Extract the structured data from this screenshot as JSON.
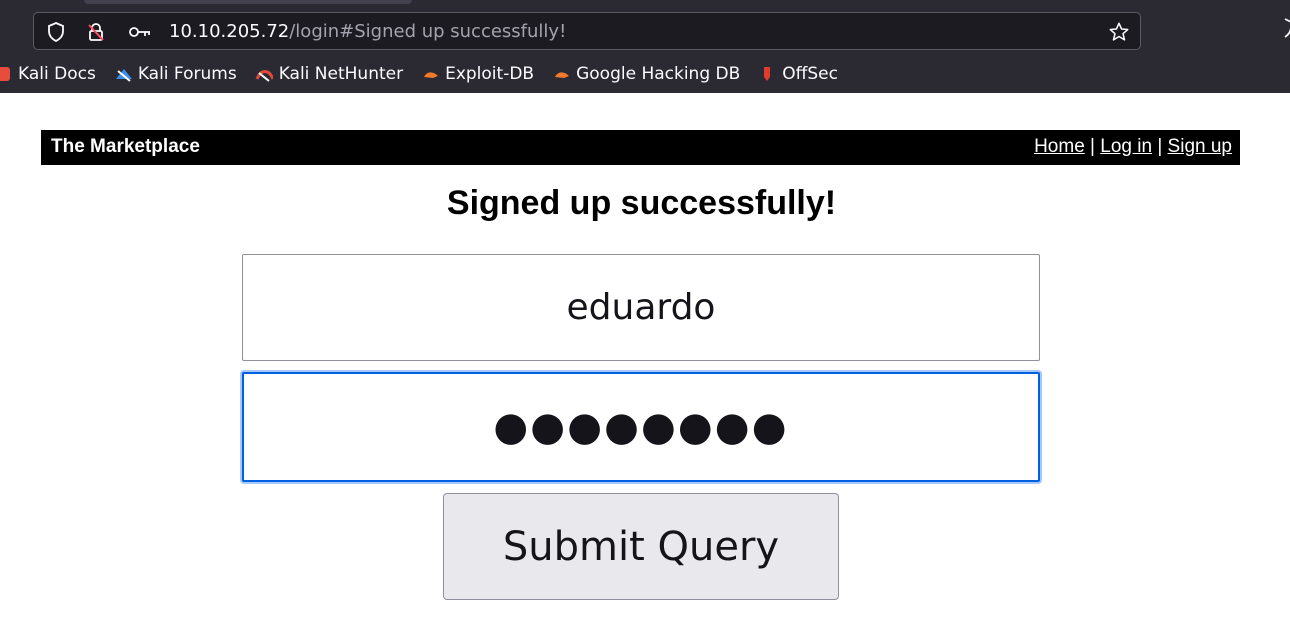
{
  "browser": {
    "url_host": "10.10.205.72",
    "url_path": "/login#Signed up successfully!",
    "bookmarks": [
      {
        "label": "Kali Docs",
        "color": "#e74c3c"
      },
      {
        "label": "Kali Forums",
        "color": "#3a8ee6"
      },
      {
        "label": "Kali NetHunter",
        "color": "#e04a3a"
      },
      {
        "label": "Exploit-DB",
        "color": "#f27a2a"
      },
      {
        "label": "Google Hacking DB",
        "color": "#f27a2a"
      },
      {
        "label": "OffSec",
        "color": "#e03c2e"
      }
    ]
  },
  "site": {
    "title": "The Marketplace",
    "nav": {
      "home": "Home",
      "login": "Log in",
      "signup": "Sign up",
      "separator": "|"
    }
  },
  "page": {
    "heading": "Signed up successfully!",
    "username_value": "eduardo",
    "password_value": "●●●●●●●●",
    "submit_label": "Submit Query"
  },
  "colors": {
    "chrome_bg": "#2b2a33",
    "focus_ring": "#0061e0",
    "button_bg": "#e9e9ed"
  }
}
